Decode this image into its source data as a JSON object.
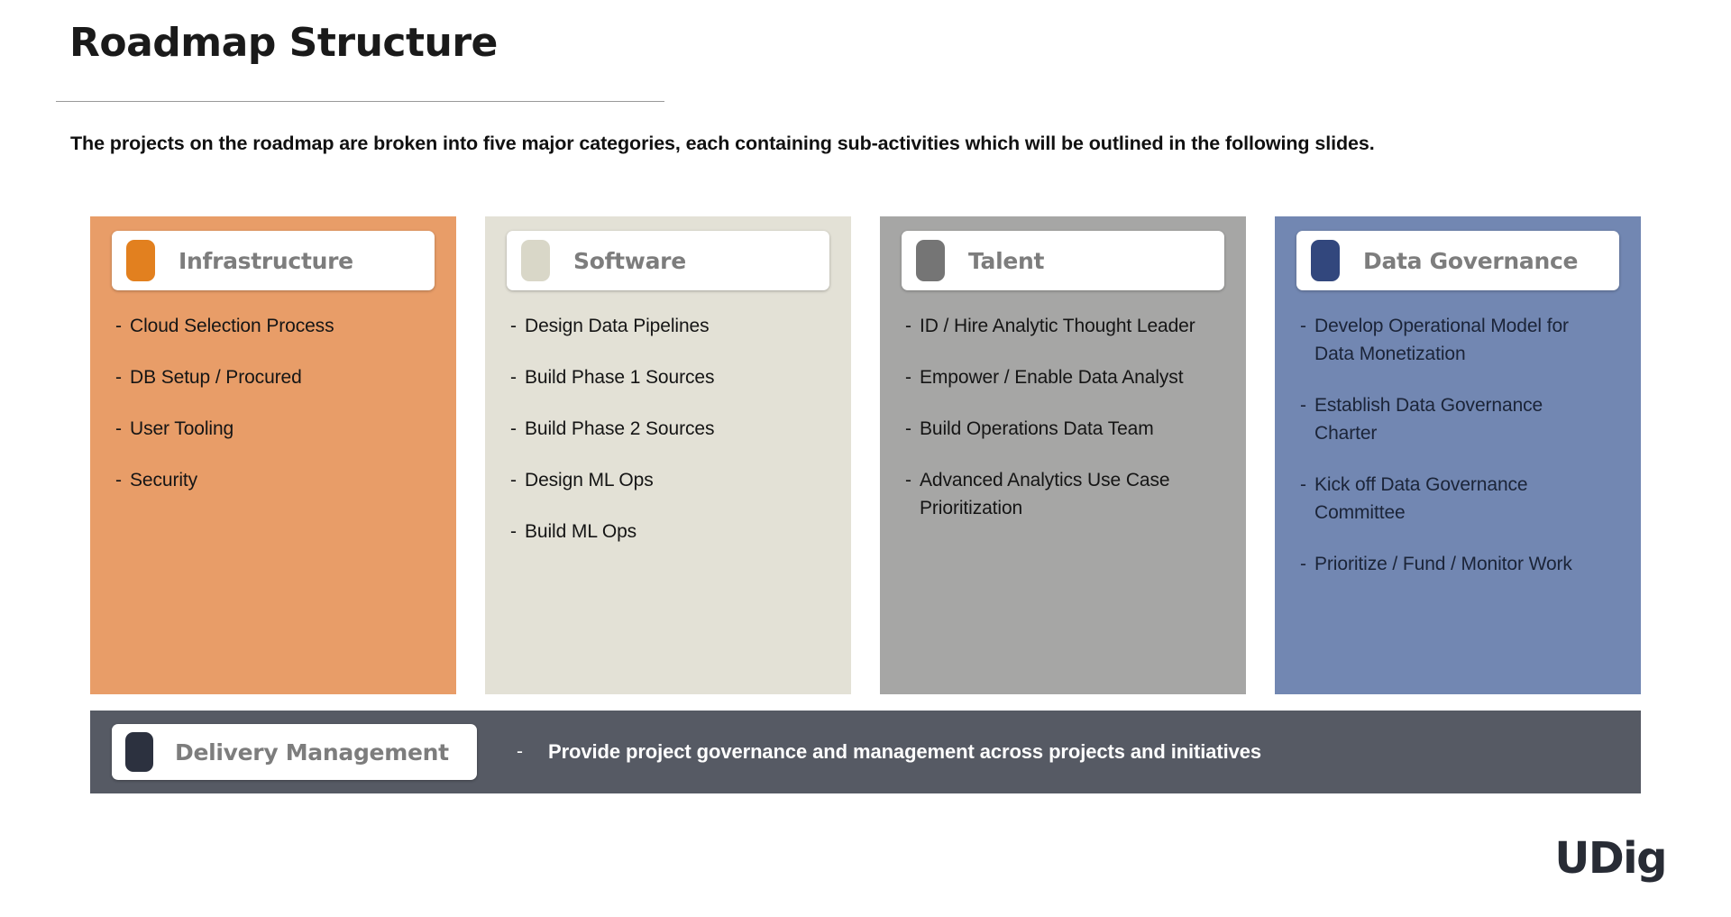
{
  "slide": {
    "title": "Roadmap Structure",
    "subtitle": "The projects on the roadmap are broken into five major categories, each containing sub-activities which will be outlined in the following slides.",
    "brand": "UDig"
  },
  "categories": [
    {
      "name": "Infrastructure",
      "bg_color": "#e89d68",
      "chip_color": "#e2801f",
      "items": [
        "Cloud Selection Process",
        "DB Setup / Procured",
        "User Tooling",
        "Security"
      ]
    },
    {
      "name": "Software",
      "bg_color": "#e3e1d6",
      "chip_color": "#d9d7c8",
      "items": [
        "Design Data Pipelines",
        "Build Phase 1 Sources",
        "Build Phase 2 Sources",
        "Design ML Ops",
        "Build ML Ops"
      ]
    },
    {
      "name": "Talent",
      "bg_color": "#a6a6a5",
      "chip_color": "#757575",
      "items": [
        "ID / Hire Analytic Thought Leader",
        "Empower / Enable Data Analyst",
        "Build Operations Data Team",
        "Advanced Analytics Use Case Prioritization"
      ]
    },
    {
      "name": "Data Governance",
      "bg_color": "#7287b2",
      "chip_color": "#32477d",
      "items": [
        "Develop Operational Model for Data Monetization",
        "Establish Data Governance Charter",
        "Kick off Data Governance Committee",
        "Prioritize / Fund / Monitor Work"
      ]
    }
  ],
  "delivery": {
    "name": "Delivery Management",
    "bg_color": "#565a64",
    "chip_color": "#2c313f",
    "bullet_dash": "-",
    "description": "Provide project governance and management across projects and initiatives"
  },
  "bullet_dash": "-"
}
